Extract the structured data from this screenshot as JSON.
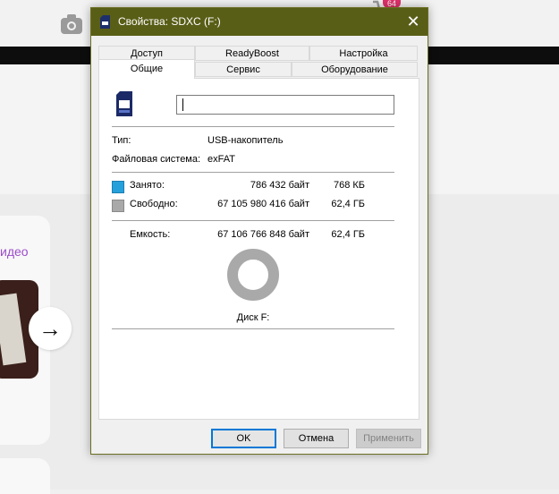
{
  "background": {
    "side_link": "идео",
    "cart_badge": "64",
    "icons": [
      "camera-icon",
      "cart-icon",
      "arrow-right-icon"
    ]
  },
  "dialog": {
    "title": "Свойства: SDXC (F:)",
    "tabs_row1": [
      "Доступ",
      "ReadyBoost",
      "Настройка"
    ],
    "tabs_row2": [
      "Общие",
      "Сервис",
      "Оборудование"
    ],
    "active_tab": "Общие",
    "name_value": "",
    "type_label": "Тип:",
    "type_value": "USB-накопитель",
    "fs_label": "Файловая система:",
    "fs_value": "exFAT",
    "used_label": "Занято:",
    "used_bytes": "786 432 байт",
    "used_size": "768 КБ",
    "free_label": "Свободно:",
    "free_bytes": "67 105 980 416 байт",
    "free_size": "62,4 ГБ",
    "capacity_label": "Емкость:",
    "capacity_bytes": "67 106 766 848 байт",
    "capacity_size": "62,4 ГБ",
    "disk_label": "Диск F:",
    "used_fraction": 1.17e-05,
    "colors": {
      "used": "#26a0da",
      "free": "#a9a9a9",
      "titlebar": "#595e17"
    },
    "buttons": {
      "ok": "OK",
      "cancel": "Отмена",
      "apply": "Применить"
    }
  }
}
